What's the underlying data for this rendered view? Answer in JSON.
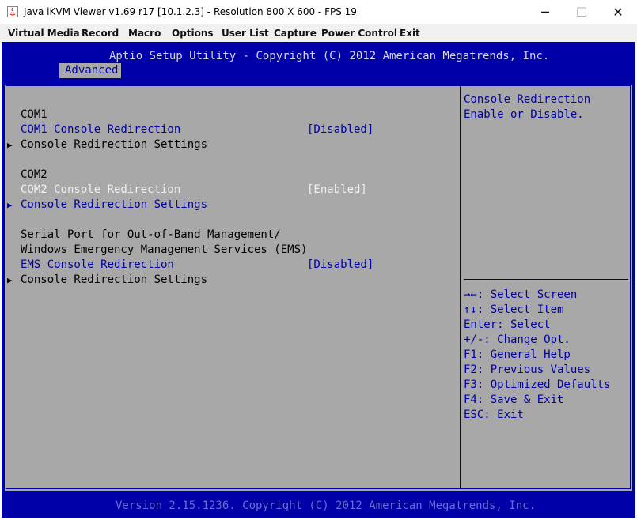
{
  "window": {
    "title": "Java iKVM Viewer v1.69 r17 [10.1.2.3]  - Resolution 800 X 600 - FPS 19",
    "minimize": "─",
    "maximize": "☐",
    "close": "✕"
  },
  "menu": [
    "Virtual Media",
    "Record",
    "Macro",
    "Options",
    "User List",
    "Capture",
    "Power Control",
    "Exit"
  ],
  "bios": {
    "header_title": "Aptio Setup Utility - Copyright (C) 2012 American Megatrends, Inc.",
    "active_tab": "Advanced",
    "items": [
      {
        "label": "COM1"
      },
      {
        "label": "COM1 Console Redirection",
        "value": "[Disabled]"
      },
      {
        "label": "Console Redirection Settings",
        "arrow": "▶"
      },
      {
        "label": "COM2"
      },
      {
        "label": "COM2 Console Redirection",
        "value": "[Enabled]"
      },
      {
        "label": "Console Redirection Settings",
        "arrow": "▶"
      },
      {
        "label": "Serial Port for Out-of-Band Management/"
      },
      {
        "label": "Windows Emergency Management Services (EMS)"
      },
      {
        "label": "EMS Console Redirection",
        "value": "[Disabled]"
      },
      {
        "label": "Console Redirection Settings",
        "arrow": "▶"
      }
    ],
    "help_text": [
      "Console Redirection",
      "Enable or Disable."
    ],
    "key_help": [
      "→←: Select Screen",
      "↑↓: Select Item",
      "Enter: Select",
      "+/-: Change Opt.",
      "F1: General Help",
      "F2: Previous Values",
      "F3: Optimized Defaults",
      "F4: Save & Exit",
      "ESC: Exit"
    ],
    "footer": "Version 2.15.1236. Copyright (C) 2012 American Megatrends, Inc."
  },
  "colors": {
    "bios_blue": "#0000a8",
    "bios_gray": "#a8a8a8",
    "bios_white": "#f0f0f0"
  }
}
